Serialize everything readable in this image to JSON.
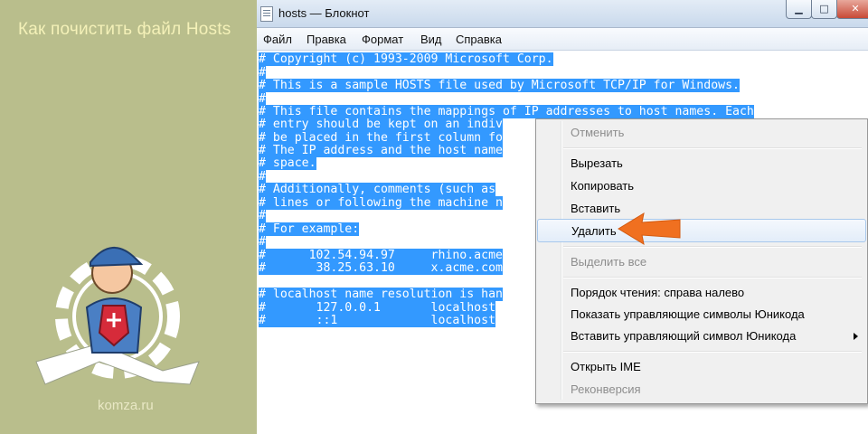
{
  "banner": {
    "title": "Как почистить файл Hosts",
    "site": "komza.ru"
  },
  "window": {
    "title": "hosts — Блокнот",
    "icon": "notepad-icon",
    "buttons": [
      "minimize-icon",
      "maximize-icon",
      "close-icon"
    ]
  },
  "menu": {
    "file": "Файл",
    "edit": "Правка",
    "format": "Формат",
    "view": "Вид",
    "help": "Справка"
  },
  "editor": {
    "lines": [
      "# Copyright (c) 1993-2009 Microsoft Corp.",
      "#",
      "# This is a sample HOSTS file used by Microsoft TCP/IP for Windows.",
      "#",
      "# This file contains the mappings of IP addresses to host names. Each",
      "# entry should be kept on an indiv",
      "# be placed in the first column fo",
      "# The IP address and the host name",
      "# space.",
      "#",
      "# Additionally, comments (such as",
      "# lines or following the machine n",
      "#",
      "# For example:",
      "#",
      "#      102.54.94.97     rhino.acme",
      "#       38.25.63.10     x.acme.com",
      "",
      "# localhost name resolution is han",
      "#       127.0.0.1       localhost",
      "#       ::1             localhost"
    ],
    "selection_color": "#3399ff"
  },
  "context_menu": {
    "undo": "Отменить",
    "cut": "Вырезать",
    "copy": "Копировать",
    "paste": "Вставить",
    "delete": "Удалить",
    "select_all": "Выделить все",
    "rtl": "Порядок чтения: справа налево",
    "show_unicode": "Показать управляющие символы Юникода",
    "insert_unicode": "Вставить управляющий символ Юникода",
    "open_ime": "Открыть IME",
    "reconversion": "Реконверсия"
  },
  "colors": {
    "banner_bg": "#b9be8c",
    "arrow": "#f07020"
  }
}
